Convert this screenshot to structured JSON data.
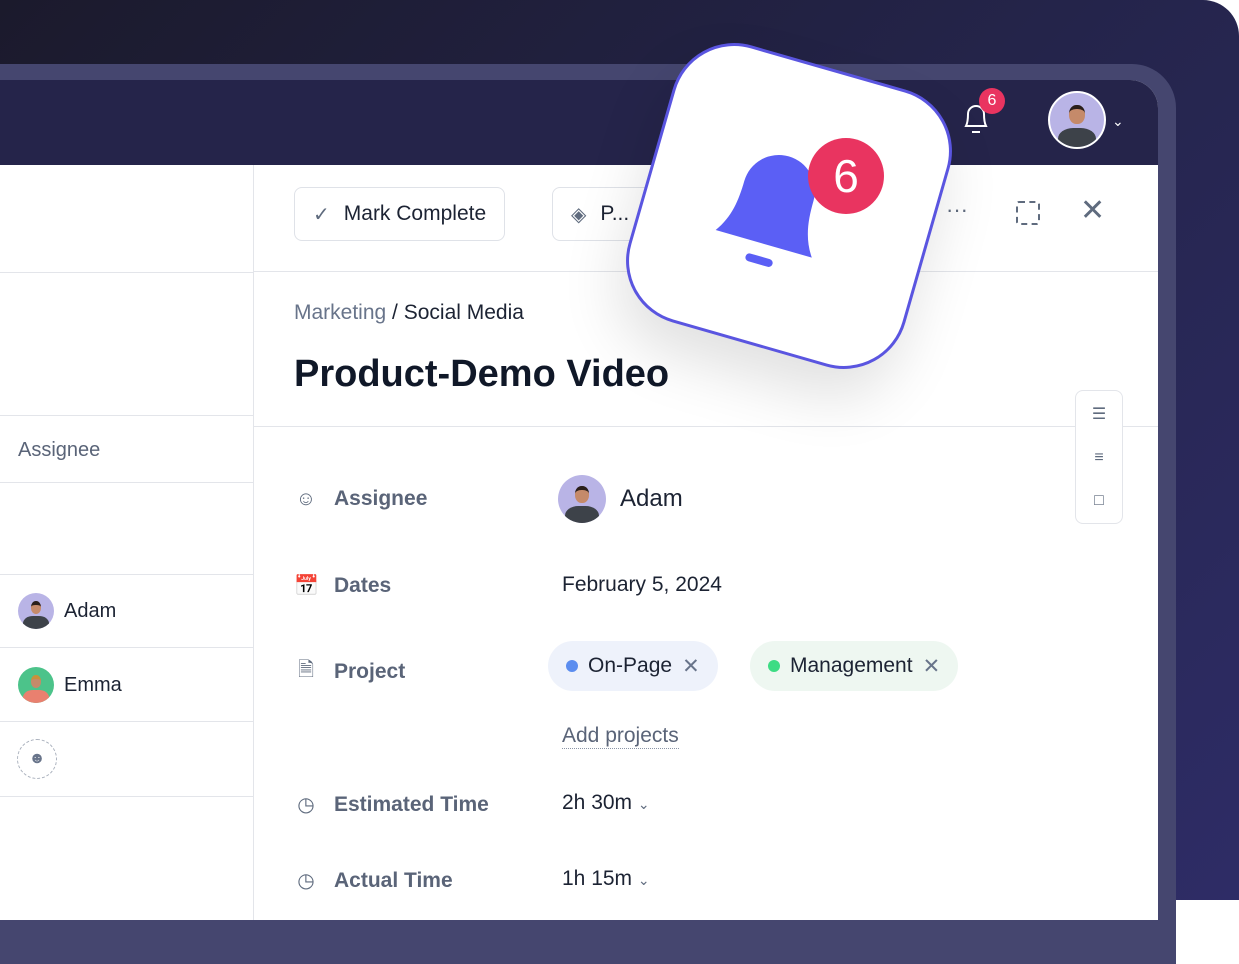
{
  "header": {
    "notification_count": "6"
  },
  "toolbar": {
    "mark_complete": "Mark Complete",
    "second_button": "P..."
  },
  "left_panel": {
    "column_header": "Assignee",
    "rows": [
      {
        "name": "Adam"
      },
      {
        "name": "Emma"
      },
      {
        "name": ""
      }
    ]
  },
  "task": {
    "breadcrumb_parent": "Marketing",
    "breadcrumb_sep": " / ",
    "breadcrumb_child": "Social Media",
    "title": "Product-Demo Video",
    "fields": {
      "assignee_label": "Assignee",
      "assignee_value": "Adam",
      "dates_label": "Dates",
      "dates_value": "February 5, 2024",
      "project_label": "Project",
      "projects": [
        {
          "name": "On-Page",
          "color": "#5b8def"
        },
        {
          "name": "Management",
          "color": "#3ddc84"
        }
      ],
      "add_projects": "Add projects",
      "estimated_label": "Estimated Time",
      "estimated_value": "2h 30m",
      "actual_label": "Actual Time",
      "actual_value": "1h 15m"
    }
  },
  "popup": {
    "count": "6"
  },
  "colors": {
    "accent": "#5a55e0",
    "badge": "#e93460",
    "header": "#25244a"
  }
}
